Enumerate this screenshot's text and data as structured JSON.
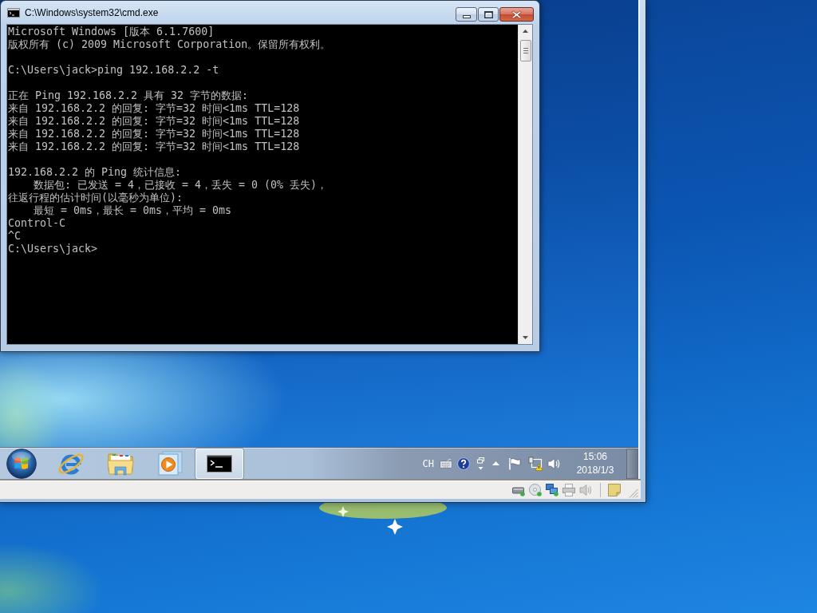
{
  "cmd_window": {
    "title": "C:\\Windows\\system32\\cmd.exe",
    "output_blocks": [
      [
        "Microsoft Windows [版本 6.1.7600]",
        "版权所有 (c) 2009 Microsoft Corporation。保留所有权利。"
      ],
      [
        "C:\\Users\\jack>ping 192.168.2.2 -t"
      ],
      [
        "正在 Ping 192.168.2.2 具有 32 字节的数据:",
        "来自 192.168.2.2 的回复: 字节=32 时间<1ms TTL=128",
        "来自 192.168.2.2 的回复: 字节=32 时间<1ms TTL=128",
        "来自 192.168.2.2 的回复: 字节=32 时间<1ms TTL=128",
        "来自 192.168.2.2 的回复: 字节=32 时间<1ms TTL=128"
      ],
      [
        "192.168.2.2 的 Ping 统计信息:",
        "    数据包: 已发送 = 4，已接收 = 4，丢失 = 0 (0% 丢失)，",
        "往返行程的估计时间(以毫秒为单位):",
        "    最短 = 0ms，最长 = 0ms，平均 = 0ms",
        "Control-C",
        "^C",
        "C:\\Users\\jack>"
      ]
    ]
  },
  "taskbar": {
    "buttons": [
      {
        "kind": "browser",
        "selected": false
      },
      {
        "kind": "folder",
        "selected": false
      },
      {
        "kind": "media",
        "selected": false
      },
      {
        "kind": "terminal",
        "selected": true
      }
    ],
    "input_language": "CH",
    "clock": {
      "time": "15:06",
      "date": "2018/1/3"
    }
  }
}
